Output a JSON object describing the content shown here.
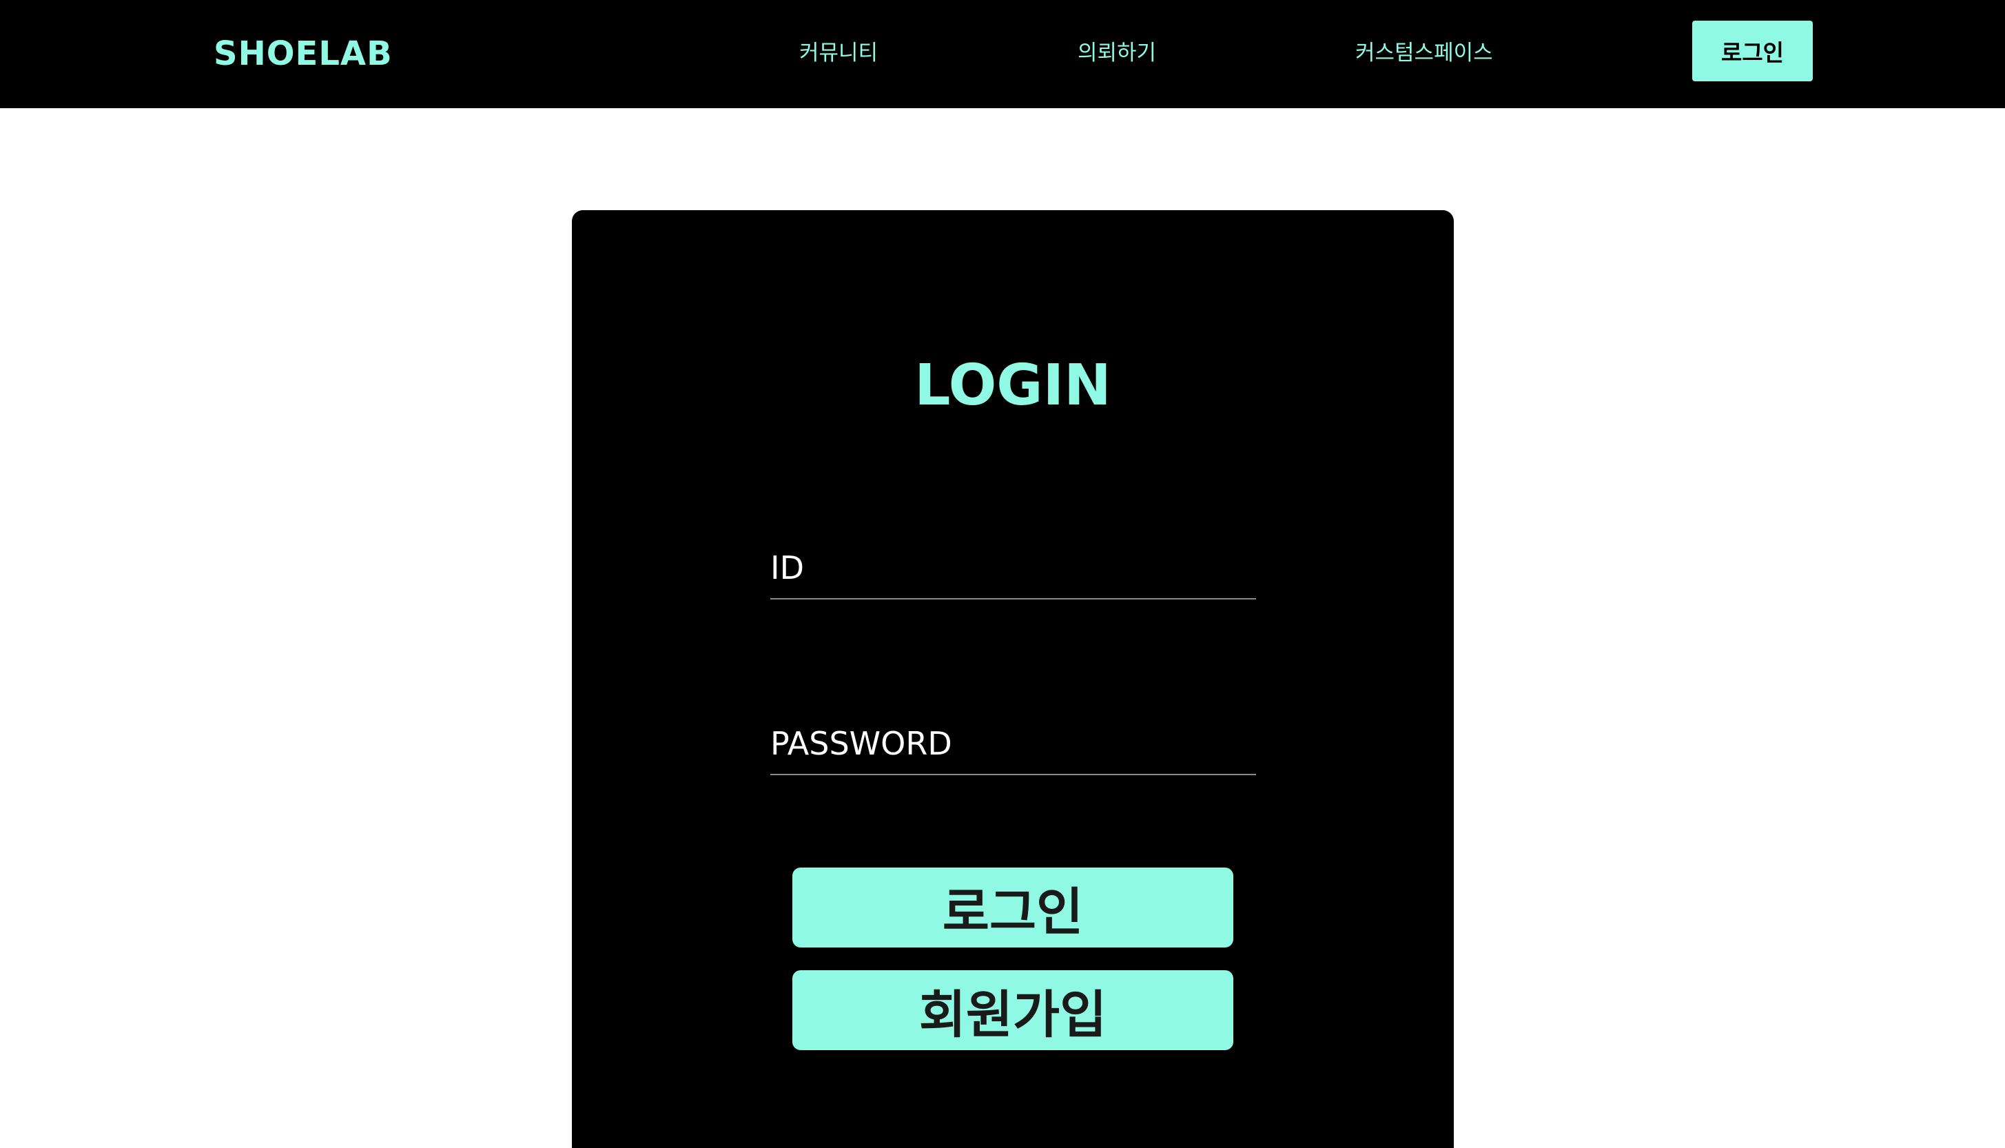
{
  "header": {
    "logo": "SHOELAB",
    "nav": {
      "community": "커뮤니티",
      "request": "의뢰하기",
      "custom_space": "커스텀스페이스"
    },
    "login_button": "로그인"
  },
  "login_form": {
    "title": "LOGIN",
    "id_placeholder": "ID",
    "password_placeholder": "PASSWORD",
    "login_button": "로그인",
    "signup_button": "회원가입"
  },
  "colors": {
    "accent": "#8ff9e3",
    "background": "#000000",
    "page": "#ffffff"
  }
}
